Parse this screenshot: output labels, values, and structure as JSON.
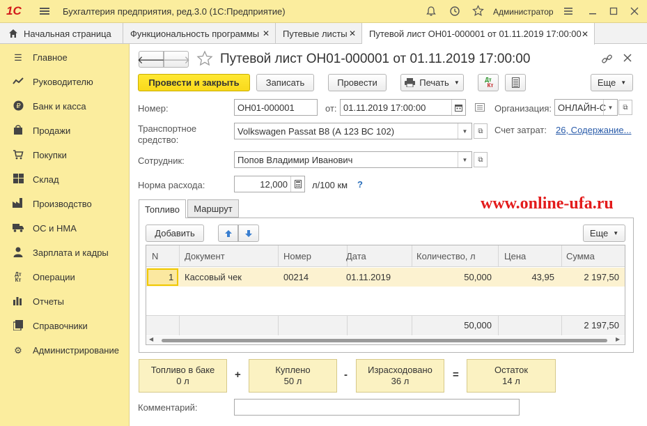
{
  "app": {
    "logo": "1С",
    "title": "Бухгалтерия предприятия, ред.3.0  (1С:Предприятие)",
    "user": "Администратор"
  },
  "tabs": [
    {
      "label": "Начальная страница"
    },
    {
      "label": "Функциональность программы"
    },
    {
      "label": "Путевые листы"
    },
    {
      "label": "Путевой лист ОН01-000001 от 01.11.2019 17:00:00"
    }
  ],
  "sidebar": {
    "items": [
      {
        "label": "Главное"
      },
      {
        "label": "Руководителю"
      },
      {
        "label": "Банк и касса"
      },
      {
        "label": "Продажи"
      },
      {
        "label": "Покупки"
      },
      {
        "label": "Склад"
      },
      {
        "label": "Производство"
      },
      {
        "label": "ОС и НМА"
      },
      {
        "label": "Зарплата и кадры"
      },
      {
        "label": "Операции"
      },
      {
        "label": "Отчеты"
      },
      {
        "label": "Справочники"
      },
      {
        "label": "Администрирование"
      }
    ]
  },
  "doc": {
    "title": "Путевой лист ОН01-000001 от 01.11.2019 17:00:00",
    "toolbar": {
      "post_close": "Провести и закрыть",
      "save": "Записать",
      "post": "Провести",
      "print": "Печать",
      "dtkt_top": "Дт",
      "dtkt_bottom": "Кт",
      "more": "Еще"
    },
    "fields": {
      "number_label": "Номер:",
      "number_value": "ОН01-000001",
      "date_label": "от:",
      "date_value": "01.11.2019 17:00:00",
      "org_label": "Организация:",
      "org_value": "ОНЛАЙН-С",
      "vehicle_label": "Транспортное средство:",
      "vehicle_value": "Volkswagen Passat B8 (А 123 ВС 102)",
      "cost_label": "Счет затрат:",
      "cost_value": "26, Содержание...",
      "employee_label": "Сотрудник:",
      "employee_value": "Попов Владимир Иванович",
      "norm_label": "Норма расхода:",
      "norm_value": "12,000",
      "norm_unit": "л/100 км",
      "help": "?"
    },
    "watermark": "www.online-ufa.ru",
    "inner_tabs": [
      {
        "label": "Топливо"
      },
      {
        "label": "Маршрут"
      }
    ],
    "grid_toolbar": {
      "add": "Добавить",
      "more": "Еще"
    },
    "grid": {
      "columns": [
        "N",
        "Документ",
        "Номер",
        "Дата",
        "Количество, л",
        "Цена",
        "Сумма"
      ],
      "rows": [
        {
          "n": "1",
          "doc": "Кассовый чек",
          "num": "00214",
          "date": "01.11.2019",
          "qty": "50,000",
          "price": "43,95",
          "sum": "2 197,50"
        }
      ],
      "footer": {
        "qty": "50,000",
        "sum": "2 197,50"
      }
    },
    "summary": {
      "tank": {
        "label": "Топливо в баке",
        "value": "0 л"
      },
      "bought": {
        "label": "Куплено",
        "value": "50 л"
      },
      "used": {
        "label": "Израсходовано",
        "value": "36 л"
      },
      "rest": {
        "label": "Остаток",
        "value": "14 л"
      },
      "plus": "+",
      "minus": "-",
      "eq": "="
    },
    "comment_label": "Комментарий:",
    "comment_value": ""
  }
}
